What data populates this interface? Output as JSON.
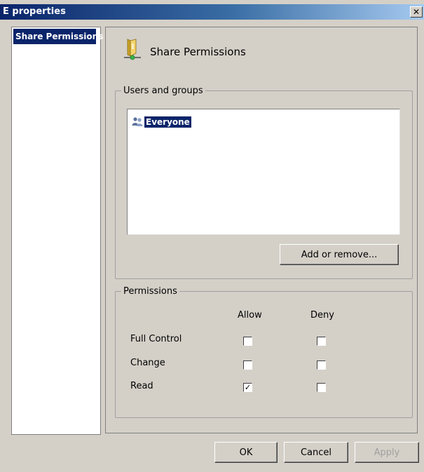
{
  "window": {
    "title": "E properties",
    "close_glyph": "✕"
  },
  "sidebar": {
    "items": [
      {
        "label": "Share Permissions",
        "selected": true
      }
    ]
  },
  "header": {
    "icon": "shared-folder-icon",
    "title": "Share Permissions"
  },
  "users_group": {
    "legend": "Users and groups",
    "items": [
      {
        "label": "Everyone",
        "icon": "user-group-icon",
        "selected": true
      }
    ],
    "add_remove_label": "Add or remove..."
  },
  "permissions_group": {
    "legend": "Permissions",
    "columns": {
      "allow": "Allow",
      "deny": "Deny"
    },
    "rows": [
      {
        "label": "Full Control",
        "allow": false,
        "deny": false
      },
      {
        "label": "Change",
        "allow": false,
        "deny": false
      },
      {
        "label": "Read",
        "allow": true,
        "deny": false
      }
    ]
  },
  "footer": {
    "ok_label": "OK",
    "cancel_label": "Cancel",
    "apply_label": "Apply",
    "apply_enabled": false
  },
  "colors": {
    "selection": "#0a246a",
    "dialog_bg": "#d4d0c8"
  }
}
